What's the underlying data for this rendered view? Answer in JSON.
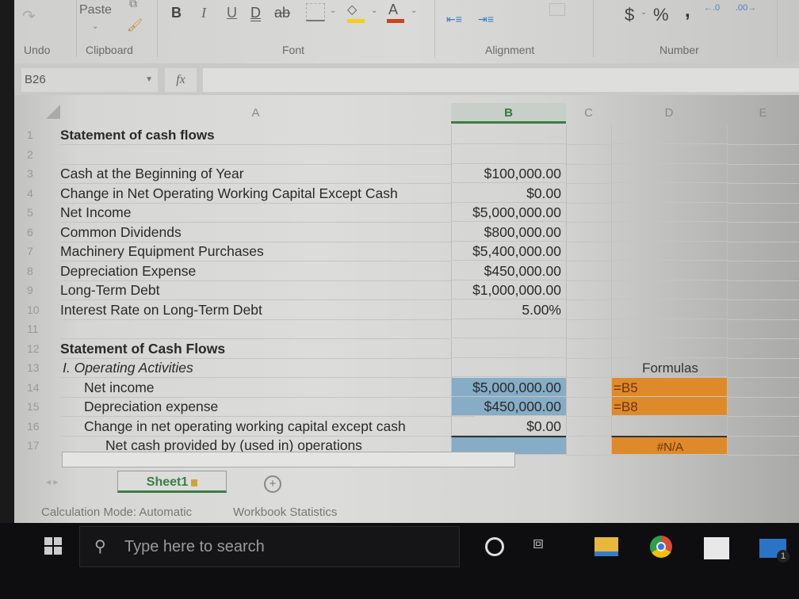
{
  "ribbon": {
    "undo_label": "Undo",
    "clipboard_label": "Clipboard",
    "paste_label": "Paste",
    "font_label": "Font",
    "alignment_label": "Alignment",
    "number_label": "Number",
    "bold": "B",
    "italic": "I",
    "underline": "U",
    "double_underline": "D",
    "strikethrough": "ab",
    "currency": "$",
    "percent": "%",
    "comma": ",",
    "increase_decimal": "←.0",
    "decrease_decimal": ".00→",
    "fill_color": "#f2d01a",
    "font_color": "#d0421b"
  },
  "formula_bar": {
    "name_box": "B26",
    "fx": "fx",
    "value": ""
  },
  "columns": [
    "A",
    "B",
    "C",
    "D",
    "E"
  ],
  "selected_column": "B",
  "rows": [
    {
      "n": "1",
      "a": "Statement of cash flows",
      "b": "",
      "d": ""
    },
    {
      "n": "2",
      "a": "",
      "b": "",
      "d": ""
    },
    {
      "n": "3",
      "a": "Cash at the Beginning of Year",
      "b": "$100,000.00",
      "d": ""
    },
    {
      "n": "4",
      "a": "Change in Net Operating Working Capital Except Cash",
      "b": "$0.00",
      "d": ""
    },
    {
      "n": "5",
      "a": "Net Income",
      "b": "$5,000,000.00",
      "d": ""
    },
    {
      "n": "6",
      "a": "Common Dividends",
      "b": "$800,000.00",
      "d": ""
    },
    {
      "n": "7",
      "a": "Machinery Equipment Purchases",
      "b": "$5,400,000.00",
      "d": ""
    },
    {
      "n": "8",
      "a": "Depreciation Expense",
      "b": "$450,000.00",
      "d": ""
    },
    {
      "n": "9",
      "a": "Long-Term Debt",
      "b": "$1,000,000.00",
      "d": ""
    },
    {
      "n": "10",
      "a": "Interest Rate on Long-Term Debt",
      "b": "5.00%",
      "d": ""
    },
    {
      "n": "11",
      "a": "",
      "b": "",
      "d": ""
    },
    {
      "n": "12",
      "a": "Statement of Cash Flows",
      "b": "",
      "d": ""
    },
    {
      "n": "13",
      "a": "I.  Operating Activities",
      "b": "",
      "d": "Formulas"
    },
    {
      "n": "14",
      "a": "Net income",
      "b": "$5,000,000.00",
      "d": "=B5"
    },
    {
      "n": "15",
      "a": "Depreciation expense",
      "b": "$450,000.00",
      "d": "=B8"
    },
    {
      "n": "16",
      "a": "Change in net operating working capital except cash",
      "b": "$0.00",
      "d": ""
    },
    {
      "n": "17",
      "a": "Net cash provided by (used in) operations",
      "b": "",
      "d": "#N/A"
    }
  ],
  "colors": {
    "input_fill": "#86acc6",
    "formula_fill": "#de8a2a",
    "selected_header": "#3b7d45"
  },
  "sheet_tabs": [
    {
      "label": "Sheet1",
      "locked": true,
      "active": true
    }
  ],
  "status_bar": {
    "calc_mode": "Calculation Mode: Automatic",
    "stats": "Workbook Statistics"
  },
  "taskbar": {
    "search_placeholder": "Type here to search",
    "mail_badge": "1"
  }
}
